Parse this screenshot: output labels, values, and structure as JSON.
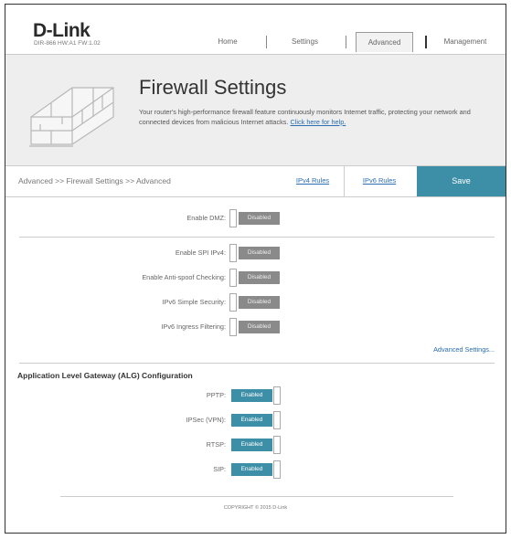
{
  "header": {
    "logo": "D-Link",
    "device_info": "DIR-866  HW:A1  FW:1.02",
    "nav": {
      "home": "Home",
      "settings": "Settings",
      "advanced": "Advanced",
      "management": "Management"
    }
  },
  "banner": {
    "title": "Firewall Settings",
    "description": "Your router's high-performance firewall feature continuously monitors Internet traffic, protecting your network and connected devices from malicious Internet attacks.",
    "help_link": "Click here for help."
  },
  "breadcrumb": "Advanced >> Firewall Settings >> Advanced",
  "tabs": {
    "ipv4_rules": "IPv4 Rules",
    "ipv6_rules": "IPv6 Rules",
    "save": "Save"
  },
  "dmz": {
    "label": "Enable DMZ:",
    "state": "Disabled"
  },
  "security": [
    {
      "label": "Enable SPI IPv4:",
      "state": "Disabled"
    },
    {
      "label": "Enable Anti-spoof Checking:",
      "state": "Disabled"
    },
    {
      "label": "IPv6 Simple Security:",
      "state": "Disabled"
    },
    {
      "label": "IPv6 Ingress Filtering:",
      "state": "Disabled"
    }
  ],
  "advanced_settings_link": "Advanced Settings...",
  "alg": {
    "title": "Application Level Gateway (ALG) Configuration",
    "items": [
      {
        "label": "PPTP:",
        "state": "Enabled"
      },
      {
        "label": "IPSec (VPN):",
        "state": "Enabled"
      },
      {
        "label": "RTSP:",
        "state": "Enabled"
      },
      {
        "label": "SIP:",
        "state": "Enabled"
      }
    ]
  },
  "footer": {
    "copyright": "COPYRIGHT © 2015 D-Link"
  },
  "colors": {
    "accent": "#3d8fa8",
    "disabled": "#8a8a8a",
    "link": "#2a6db0"
  }
}
